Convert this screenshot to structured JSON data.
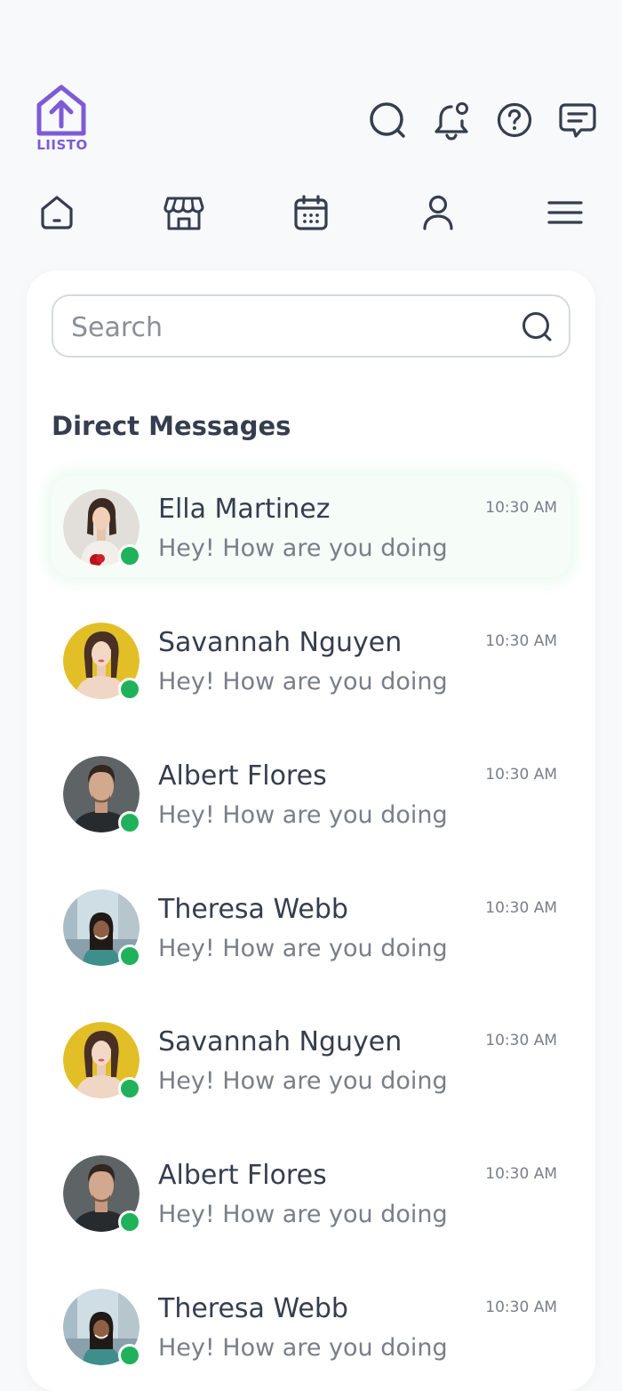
{
  "header": {
    "logo_text": "LIISTO",
    "brand_color": "#7e5bd6",
    "actions": [
      {
        "icon": "search-icon"
      },
      {
        "icon": "bell-notification-icon"
      },
      {
        "icon": "help-icon"
      },
      {
        "icon": "chat-icon"
      }
    ]
  },
  "nav": {
    "items": [
      {
        "icon": "home-icon"
      },
      {
        "icon": "store-icon"
      },
      {
        "icon": "calendar-icon"
      },
      {
        "icon": "user-icon"
      },
      {
        "icon": "menu-icon"
      }
    ]
  },
  "search": {
    "placeholder": "Search"
  },
  "messages": {
    "title": "Direct Messages",
    "online_color": "#1fb25a",
    "items": [
      {
        "name": "Ella Martinez",
        "preview": "Hey! How are you doing",
        "time": "10:30 AM",
        "online": true,
        "selected": true
      },
      {
        "name": "Savannah Nguyen",
        "preview": "Hey! How are you doing",
        "time": "10:30 AM",
        "online": true,
        "selected": false
      },
      {
        "name": "Albert Flores",
        "preview": "Hey! How are you doing",
        "time": "10:30 AM",
        "online": true,
        "selected": false
      },
      {
        "name": "Theresa Webb",
        "preview": "Hey! How are you doing",
        "time": "10:30 AM",
        "online": true,
        "selected": false
      },
      {
        "name": "Savannah Nguyen",
        "preview": "Hey! How are you doing",
        "time": "10:30 AM",
        "online": true,
        "selected": false
      },
      {
        "name": "Albert Flores",
        "preview": "Hey! How are you doing",
        "time": "10:30 AM",
        "online": true,
        "selected": false
      },
      {
        "name": "Theresa Webb",
        "preview": "Hey! How are you doing",
        "time": "10:30 AM",
        "online": true,
        "selected": false
      }
    ]
  }
}
